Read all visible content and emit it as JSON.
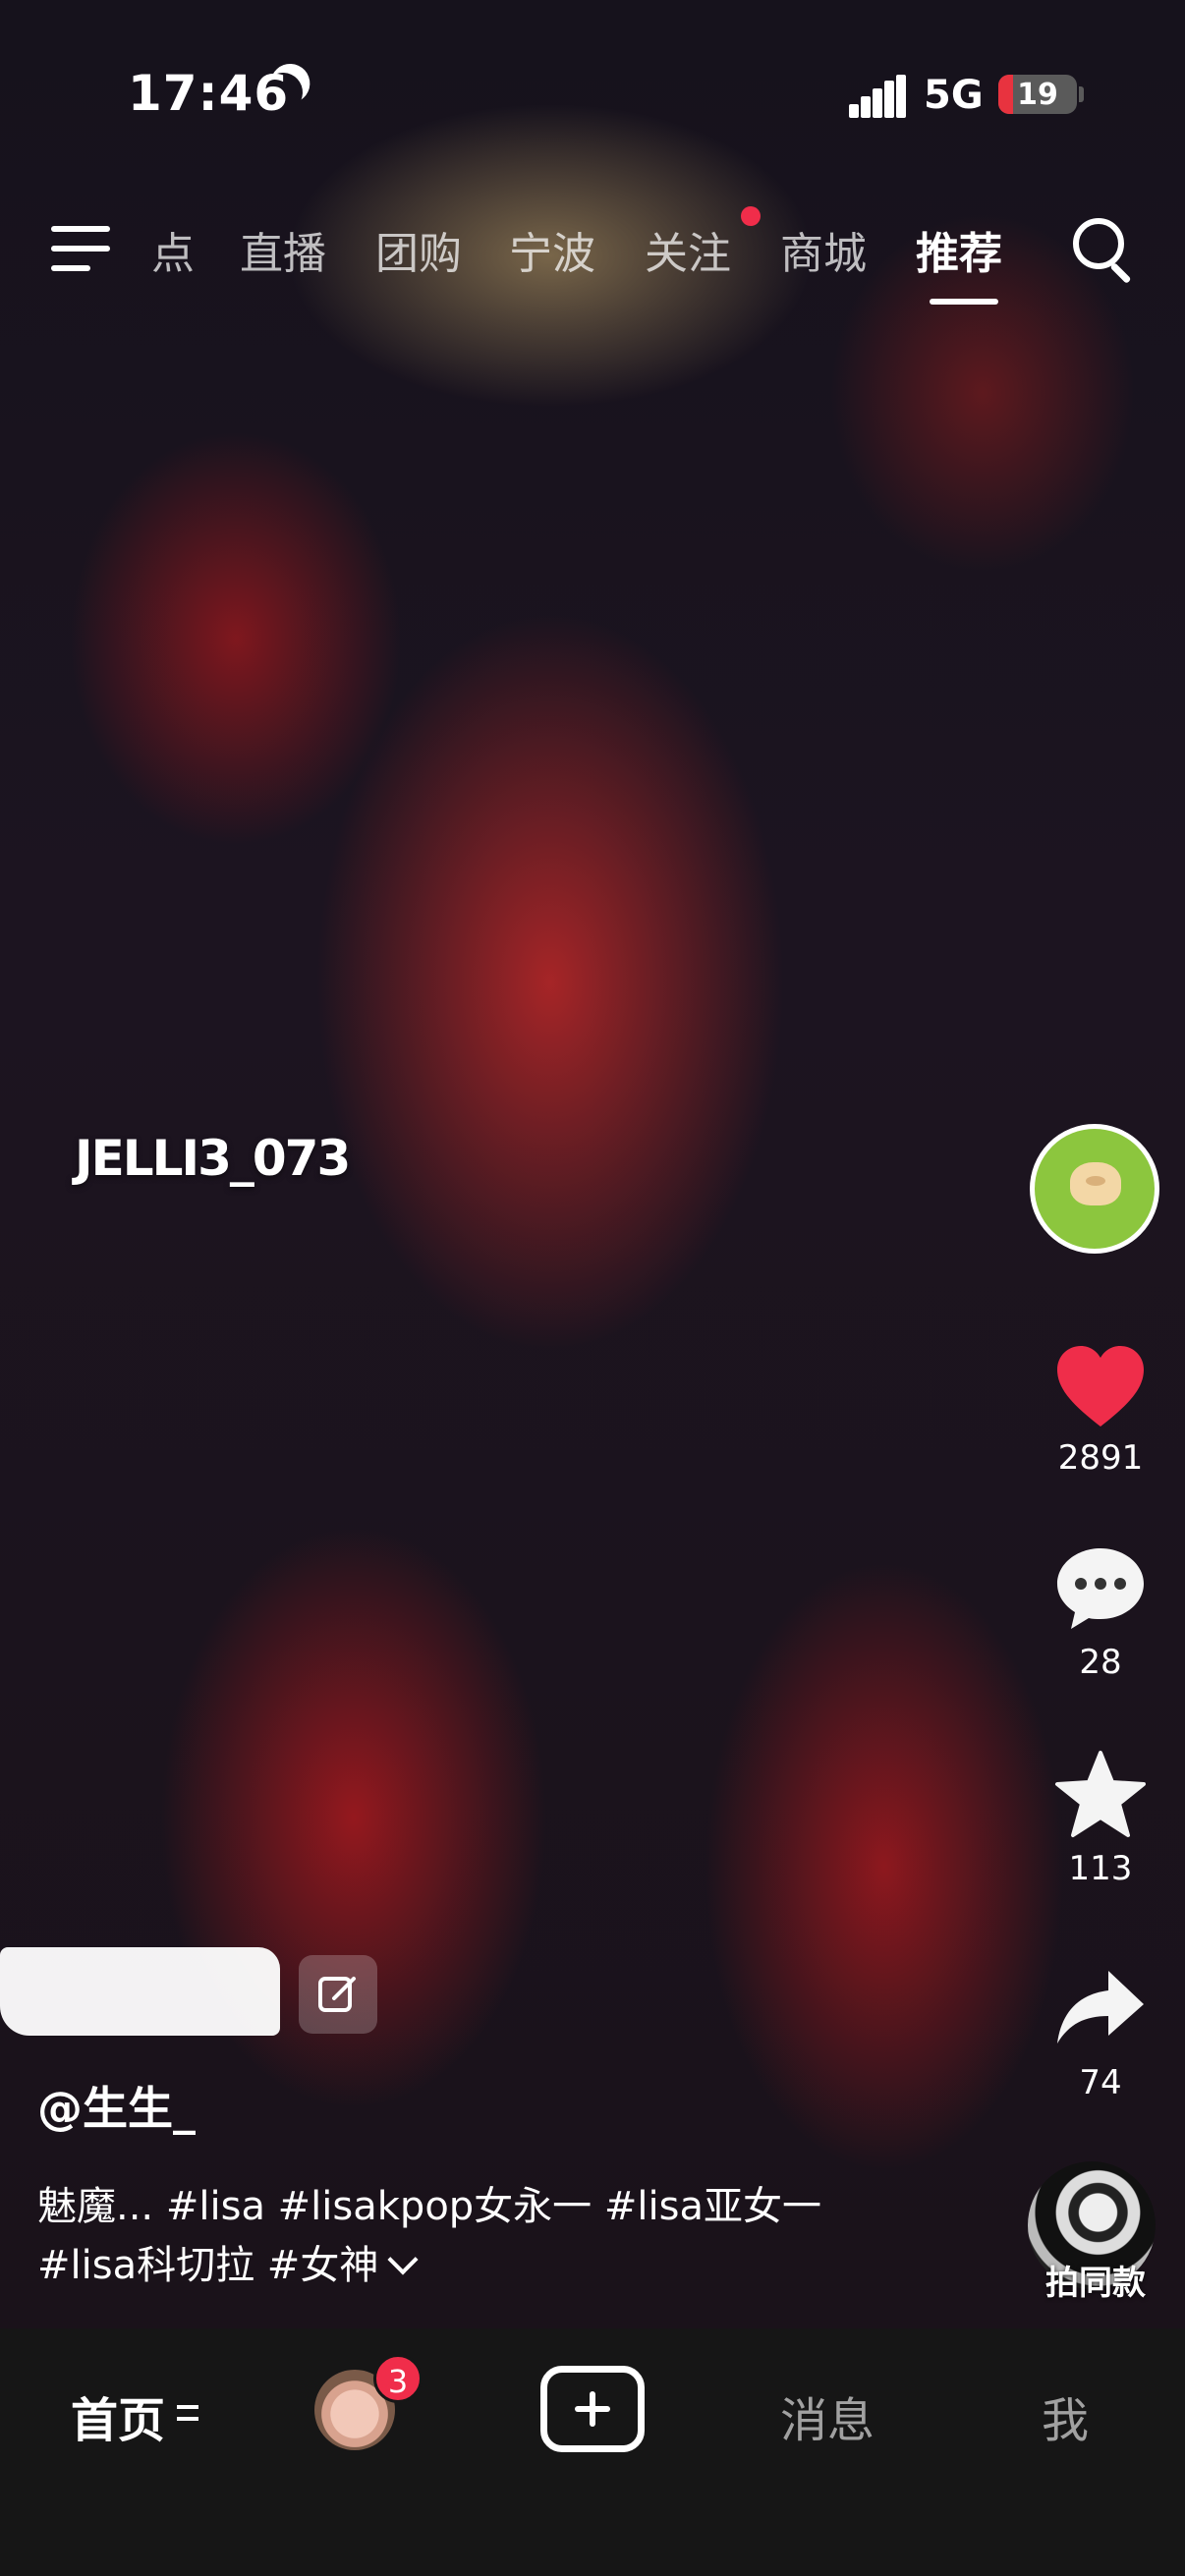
{
  "status_bar": {
    "time": "17:46",
    "network": "5G",
    "battery": "19",
    "battery_level": 0.19
  },
  "top_nav": {
    "tabs": [
      "点",
      "直播",
      "团购",
      "宁波",
      "关注",
      "商城",
      "推荐"
    ],
    "active_tab": "推荐"
  },
  "video": {
    "watermark": "JELLI3_073"
  },
  "right_rail": {
    "likes": "2891",
    "comments": "28",
    "favorites": "113",
    "shares": "74",
    "same_style_label": "拍同款"
  },
  "post": {
    "author": "@生生_",
    "caption_line1": "魅魔... #lisa #lisakpop女永一 #lisa亚女一",
    "caption_line2": "#lisa科切拉 #女神"
  },
  "bottom_nav": {
    "home": "首页",
    "friends_badge": "3",
    "messages": "消息",
    "me": "我"
  },
  "colors": {
    "accent": "#f02d4a",
    "like": "#ef2d4a",
    "avatar_ring": "#8cc63e"
  }
}
